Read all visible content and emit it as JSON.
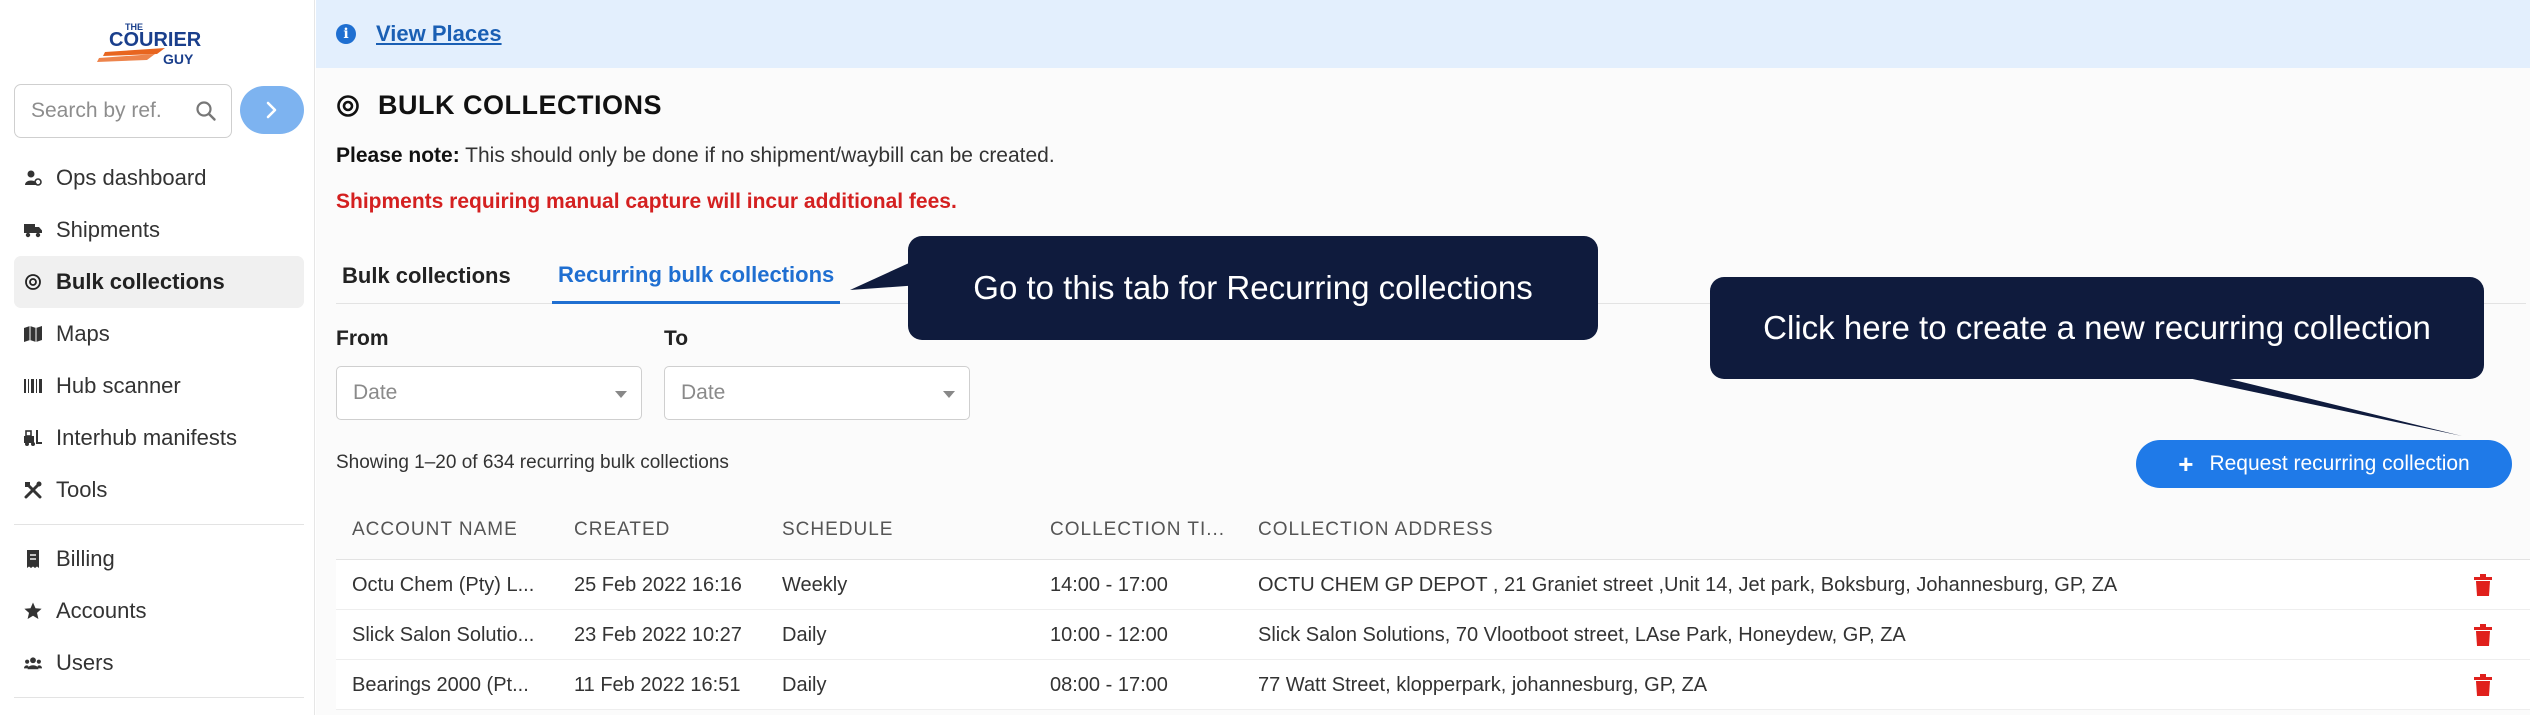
{
  "sidebar": {
    "logo_lines": [
      "THE",
      "COURIER",
      "GUY"
    ],
    "search": {
      "placeholder": "Search by ref."
    },
    "items": [
      {
        "label": "Ops dashboard",
        "icon": "ops-dashboard-icon"
      },
      {
        "label": "Shipments",
        "icon": "truck-icon"
      },
      {
        "label": "Bulk collections",
        "icon": "target-icon"
      },
      {
        "label": "Maps",
        "icon": "map-icon"
      },
      {
        "label": "Hub scanner",
        "icon": "barcode-icon"
      },
      {
        "label": "Interhub manifests",
        "icon": "forklift-icon"
      },
      {
        "label": "Tools",
        "icon": "tools-icon"
      },
      {
        "label": "Billing",
        "icon": "receipt-icon"
      },
      {
        "label": "Accounts",
        "icon": "star-icon"
      },
      {
        "label": "Users",
        "icon": "users-icon"
      }
    ]
  },
  "banner": {
    "link": "View Places"
  },
  "page": {
    "title": "BULK COLLECTIONS",
    "note_bold": "Please note:",
    "note_text": " This should only be done if no shipment/waybill can be created.",
    "warning": "Shipments requiring manual capture will incur additional fees."
  },
  "tabs": [
    {
      "label": "Bulk collections"
    },
    {
      "label": "Recurring bulk collections"
    }
  ],
  "filters": {
    "from_label": "From",
    "to_label": "To",
    "from_placeholder": "Date",
    "to_placeholder": "Date"
  },
  "showing": "Showing 1–20 of 634 recurring bulk collections",
  "request_button": "Request recurring collection",
  "table": {
    "headers": [
      "ACCOUNT NAME",
      "CREATED",
      "SCHEDULE",
      "COLLECTION TI...",
      "COLLECTION ADDRESS"
    ],
    "rows": [
      [
        "Octu Chem (Pty) L...",
        "25 Feb 2022 16:16",
        "Weekly",
        "14:00 - 17:00",
        "OCTU CHEM GP DEPOT , 21 Graniet street ,Unit 14, Jet park, Boksburg, Johannesburg, GP, ZA"
      ],
      [
        "Slick Salon Solutio...",
        "23 Feb 2022 10:27",
        "Daily",
        "10:00 - 12:00",
        "Slick Salon Solutions, 70 Vlootboot street, LAse Park, Honeydew, GP, ZA"
      ],
      [
        "Bearings 2000 (Pt...",
        "11 Feb 2022 16:51",
        "Daily",
        "08:00 - 17:00",
        "77 Watt Street, klopperpark, johannesburg, GP, ZA"
      ]
    ]
  },
  "callouts": {
    "tab": "Go to this tab for Recurring collections",
    "button": "Click here to create a new recurring collection"
  },
  "colors": {
    "accent": "#1f7ae8",
    "warning": "#d42020",
    "callout_bg": "#0f1b3d",
    "banner_bg": "#e3effd",
    "delete": "#e0201c"
  }
}
